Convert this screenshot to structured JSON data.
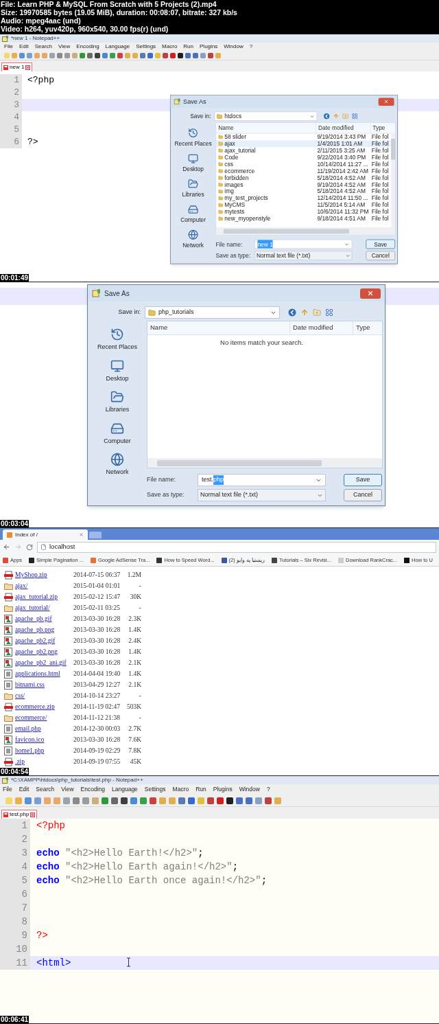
{
  "header": {
    "lines": [
      "File: Learn PHP & MySQL From Scratch with 5 Projects (2).mp4",
      "Size: 19970585 bytes (19.05 MiB), duration: 00:08:07, bitrate: 327 kb/s",
      "Audio: mpeg4aac (und)",
      "Video: h264, yuv420p, 960x540, 30.00 fps(r) (und)"
    ]
  },
  "frames": [
    {
      "kind": "notepad",
      "timestamp": "00:01:49",
      "title": "*new 1 - Notepad++",
      "menu": [
        "File",
        "Edit",
        "Search",
        "View",
        "Encoding",
        "Language",
        "Settings",
        "Macro",
        "Run",
        "Plugins",
        "Window",
        "?"
      ],
      "tabs": [
        {
          "label": "new 1",
          "selected": true
        }
      ],
      "lines": [
        {
          "number": "1",
          "current": false,
          "tokens": [
            {
              "kind": "plain",
              "text": "<?php"
            }
          ]
        },
        {
          "number": "2",
          "current": false
        },
        {
          "number": "3",
          "current": true
        },
        {
          "number": "4",
          "current": false
        },
        {
          "number": "5",
          "current": false
        },
        {
          "number": "6",
          "current": false,
          "tokens": [
            {
              "kind": "plain",
              "text": "?>"
            }
          ]
        }
      ],
      "dialog": {
        "title": "Save As",
        "save_in_label": "Save in:",
        "folder": "htdocs",
        "columns": [
          "Name",
          "Date modified",
          "Type"
        ],
        "rows": [
          {
            "name": "58 slider",
            "date": "9/19/2014 3:43 PM",
            "type": "File fol",
            "selected": false
          },
          {
            "name": "ajax",
            "date": "1/4/2015 1:01 AM",
            "type": "File fol",
            "selected": true
          },
          {
            "name": "ajax_tutorial",
            "date": "2/11/2015 3:25 AM",
            "type": "File fol",
            "selected": false
          },
          {
            "name": "Code",
            "date": "9/22/2014 3:40 PM",
            "type": "File fol",
            "selected": false
          },
          {
            "name": "css",
            "date": "10/14/2014 11:27 ...",
            "type": "File fol",
            "selected": false
          },
          {
            "name": "ecommerce",
            "date": "11/19/2014 2:42 AM",
            "type": "File fol",
            "selected": false
          },
          {
            "name": "forbidden",
            "date": "5/18/2014 4:52 AM",
            "type": "File fol",
            "selected": false
          },
          {
            "name": "images",
            "date": "9/19/2014 4:52 AM",
            "type": "File fol",
            "selected": false
          },
          {
            "name": "img",
            "date": "5/18/2014 4:52 AM",
            "type": "File fol",
            "selected": false
          },
          {
            "name": "my_test_projects",
            "date": "12/14/2014 11:50 ...",
            "type": "File fol",
            "selected": false
          },
          {
            "name": "MyCMS",
            "date": "11/5/2014 5:14 AM",
            "type": "File fol",
            "selected": false
          },
          {
            "name": "mytests",
            "date": "10/6/2014 11:32 PM",
            "type": "File fol",
            "selected": false
          },
          {
            "name": "new_myopenstyle",
            "date": "9/18/2014 4:51 AM",
            "type": "File fol",
            "selected": false
          }
        ],
        "places": [
          {
            "kind": "recent",
            "label": "Recent Places"
          },
          {
            "kind": "desktop",
            "label": "Desktop"
          },
          {
            "kind": "libraries",
            "label": "Libraries"
          },
          {
            "kind": "computer",
            "label": "Computer"
          },
          {
            "kind": "network",
            "label": "Network"
          }
        ],
        "file_name_label": "File name:",
        "file_name": [
          {
            "text": "new 1",
            "selected": true
          }
        ],
        "type_label": "Save as type:",
        "type_value": "Normal text file (*.txt)",
        "buttons": [
          "Save",
          "Cancel"
        ]
      }
    },
    {
      "kind": "dialog",
      "timestamp": "00:03:04",
      "dialog": {
        "title": "Save As",
        "save_in_label": "Save in:",
        "folder": "php_tutorials",
        "columns": [
          "Name",
          "Date modified",
          "Type"
        ],
        "empty_message": "No items match your search.",
        "places": [
          {
            "kind": "recent",
            "label": "Recent Places"
          },
          {
            "kind": "desktop",
            "label": "Desktop"
          },
          {
            "kind": "libraries",
            "label": "Libraries"
          },
          {
            "kind": "computer",
            "label": "Computer"
          },
          {
            "kind": "network",
            "label": "Network"
          }
        ],
        "file_name_label": "File name:",
        "file_name": [
          {
            "text": "test.",
            "selected": false
          },
          {
            "text": "php",
            "selected": true
          }
        ],
        "type_label": "Save as type:",
        "type_value": "Normal text file (*.txt)",
        "buttons": [
          "Save",
          "Cancel"
        ]
      }
    },
    {
      "kind": "browser",
      "timestamp": "00:04:54",
      "tab": "Index of /",
      "address": "localhost",
      "bookmarks": [
        {
          "label": "Apps",
          "color": "#e04a3a"
        },
        {
          "label": "Simple Pagination ...",
          "color": "#222222"
        },
        {
          "label": "Google AdSense Tra...",
          "color": "#e8703a"
        },
        {
          "label": "How to Speed Word...",
          "color": "#333333"
        },
        {
          "label": "ریښتیا په وایو (2)",
          "color": "#3b5998"
        },
        {
          "label": "Tutorials – Six Revisi...",
          "color": "#444444"
        },
        {
          "label": "Download RankCrac...",
          "color": "#cccccc"
        },
        {
          "label": "How to U",
          "color": "#111111"
        }
      ],
      "listing": [
        {
          "name": "MyShop.zip",
          "date": "2014-07-15 06:37",
          "size": "1.2M",
          "kind": "zip"
        },
        {
          "name": "ajax/",
          "date": "2015-01-04 01:01",
          "size": "-",
          "kind": "folder"
        },
        {
          "name": "ajax_tutorial.zip",
          "date": "2015-02-12 15:47",
          "size": "30K",
          "kind": "zip"
        },
        {
          "name": "ajax_tutorial/",
          "date": "2015-02-11 03:25",
          "size": "-",
          "kind": "folder"
        },
        {
          "name": "apache_pb.gif",
          "date": "2013-03-30 16:28",
          "size": "2.3K",
          "kind": "image"
        },
        {
          "name": "apache_pb.png",
          "date": "2013-03-30 16:28",
          "size": "1.4K",
          "kind": "image"
        },
        {
          "name": "apache_pb2.gif",
          "date": "2013-03-30 16:28",
          "size": "2.4K",
          "kind": "image"
        },
        {
          "name": "apache_pb2.png",
          "date": "2013-03-30 16:28",
          "size": "1.4K",
          "kind": "image"
        },
        {
          "name": "apache_pb2_ani.gif",
          "date": "2013-03-30 16:28",
          "size": "2.1K",
          "kind": "image"
        },
        {
          "name": "applications.html",
          "date": "2014-04-04 19:40",
          "size": "1.4K",
          "kind": "file"
        },
        {
          "name": "bitnami.css",
          "date": "2013-04-29 12:27",
          "size": "2.1K",
          "kind": "file"
        },
        {
          "name": "css/",
          "date": "2014-10-14 23:27",
          "size": "-",
          "kind": "folder"
        },
        {
          "name": "ecommerce.zip",
          "date": "2014-11-19 02:47",
          "size": "503K",
          "kind": "zip"
        },
        {
          "name": "ecommerce/",
          "date": "2014-11-12 21:38",
          "size": "-",
          "kind": "folder"
        },
        {
          "name": "email.php",
          "date": "2014-12-30 00:03",
          "size": "2.7K",
          "kind": "file"
        },
        {
          "name": "favicon.ico",
          "date": "2013-03-30 16:28",
          "size": "7.6K",
          "kind": "image"
        },
        {
          "name": "home1.php",
          "date": "2014-09-19 02:29",
          "size": "7.8K",
          "kind": "file"
        },
        {
          "name": ".zip",
          "date": "2014-09-19 07:55",
          "size": "45K",
          "kind": "zip"
        }
      ]
    },
    {
      "kind": "editor",
      "timestamp": "00:06:41",
      "title": "*C:\\XAMPP\\htdocs\\php_tutorials\\test.php - Notepad++",
      "menu": [
        "File",
        "Edit",
        "Search",
        "View",
        "Encoding",
        "Language",
        "Settings",
        "Macro",
        "Run",
        "Plugins",
        "Window",
        "?"
      ],
      "tabs": [
        {
          "label": "test.php",
          "selected": true
        }
      ],
      "lines": [
        {
          "number": "1",
          "current": false,
          "tokens": [
            {
              "kind": "php",
              "text": "<?php"
            }
          ]
        },
        {
          "number": "2",
          "current": false
        },
        {
          "number": "3",
          "current": false,
          "tokens": [
            {
              "kind": "keyword",
              "text": "echo"
            },
            {
              "kind": "string",
              "text": "\"<h2>Hello Earth!</h2>\""
            },
            {
              "kind": "plain",
              "text": ";"
            }
          ]
        },
        {
          "number": "4",
          "current": false,
          "tokens": [
            {
              "kind": "keyword",
              "text": "echo"
            },
            {
              "kind": "string",
              "text": "\"<h2>Hello Earth again!</h2>\""
            },
            {
              "kind": "plain",
              "text": ";"
            }
          ]
        },
        {
          "number": "5",
          "current": false,
          "tokens": [
            {
              "kind": "keyword",
              "text": "echo"
            },
            {
              "kind": "string",
              "text": "\"<h2>Hello Earth once again!</h2>\""
            },
            {
              "kind": "plain",
              "text": ";"
            }
          ]
        },
        {
          "number": "6",
          "current": false
        },
        {
          "number": "7",
          "current": false
        },
        {
          "number": "8",
          "current": false
        },
        {
          "number": "9",
          "current": false,
          "tokens": [
            {
              "kind": "php",
              "text": "?>"
            }
          ]
        },
        {
          "number": "10",
          "current": false
        },
        {
          "number": "11",
          "current": true,
          "tokens": [
            {
              "kind": "html",
              "text": "<html>"
            }
          ]
        }
      ]
    }
  ]
}
